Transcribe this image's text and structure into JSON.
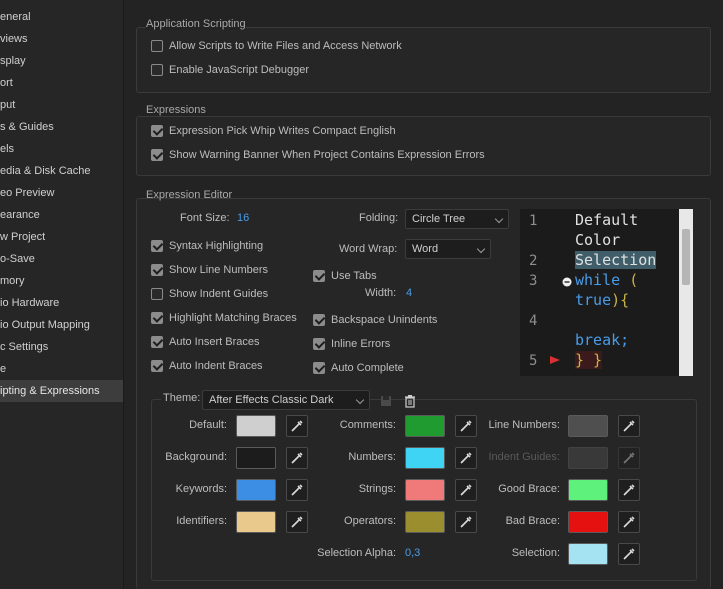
{
  "sidebar": {
    "items": [
      {
        "label": "eneral"
      },
      {
        "label": "views"
      },
      {
        "label": "splay"
      },
      {
        "label": "ort"
      },
      {
        "label": "put"
      },
      {
        "label": "s & Guides"
      },
      {
        "label": "els"
      },
      {
        "label": "edia & Disk Cache"
      },
      {
        "label": "eo Preview"
      },
      {
        "label": "earance"
      },
      {
        "label": "w Project"
      },
      {
        "label": "o-Save"
      },
      {
        "label": "mory"
      },
      {
        "label": "io Hardware"
      },
      {
        "label": "io Output Mapping"
      },
      {
        "label": "c Settings"
      },
      {
        "label": "e"
      },
      {
        "label": "ipting & Expressions"
      }
    ]
  },
  "scripting": {
    "title": "Application Scripting",
    "allow_scripts": {
      "label": "Allow Scripts to Write Files and Access Network",
      "checked": false
    },
    "js_debugger": {
      "label": "Enable JavaScript Debugger",
      "checked": false
    }
  },
  "expressions": {
    "title": "Expressions",
    "pick_whip": {
      "label": "Expression Pick Whip Writes Compact English",
      "checked": true
    },
    "warning_banner": {
      "label": "Show Warning Banner When Project Contains Expression Errors",
      "checked": true
    }
  },
  "editor": {
    "title": "Expression Editor",
    "font_size_label": "Font Size:",
    "font_size_value": "16",
    "folding_label": "Folding:",
    "folding_value": "Circle Tree",
    "word_wrap_label": "Word Wrap:",
    "word_wrap_value": "Word",
    "use_tabs": "Use Tabs",
    "width_label": "Width:",
    "width_value": "4",
    "checkboxes": {
      "syntax_highlighting": "Syntax Highlighting",
      "show_line_numbers": "Show Line Numbers",
      "show_indent_guides": "Show Indent Guides",
      "highlight_matching_braces": "Highlight Matching Braces",
      "auto_insert_braces": "Auto Insert Braces",
      "auto_indent_braces": "Auto Indent Braces",
      "backspace_unindents": "Backspace Unindents",
      "inline_errors": "Inline Errors",
      "auto_complete": "Auto Complete"
    },
    "preview": {
      "line_numbers": [
        "1",
        "2",
        "3",
        "4",
        "5"
      ],
      "line1": "Default",
      "line2": "Color",
      "line3": "Selection",
      "line4a": "while",
      "line4b": "(",
      "line5a": "true",
      "line5b": "){",
      "line6": "break;",
      "line7": "} }"
    }
  },
  "theme": {
    "label": "Theme:",
    "value": "After Effects Classic Dark",
    "colors": {
      "default": {
        "label": "Default:",
        "color": "#cfcfcf"
      },
      "background": {
        "label": "Background:",
        "color": "#1c1c1c"
      },
      "keywords": {
        "label": "Keywords:",
        "color": "#3c8ee4"
      },
      "identifiers": {
        "label": "Identifiers:",
        "color": "#e9c98c"
      },
      "comments": {
        "label": "Comments:",
        "color": "#1f9b2f"
      },
      "numbers": {
        "label": "Numbers:",
        "color": "#3fd4f4"
      },
      "strings": {
        "label": "Strings:",
        "color": "#f07a7a"
      },
      "operators": {
        "label": "Operators:",
        "color": "#9a8e2e"
      },
      "line_numbers": {
        "label": "Line Numbers:",
        "color": "#4f4f4f"
      },
      "indent_guides": {
        "label": "Indent Guides:",
        "color": "#4a4a4a"
      },
      "good_brace": {
        "label": "Good Brace:",
        "color": "#5ef27c"
      },
      "bad_brace": {
        "label": "Bad Brace:",
        "color": "#e51010"
      },
      "selection": {
        "label": "Selection:",
        "color": "#a5e2f2"
      }
    },
    "selection_alpha_label": "Selection Alpha:",
    "selection_alpha_value": "0,3"
  }
}
